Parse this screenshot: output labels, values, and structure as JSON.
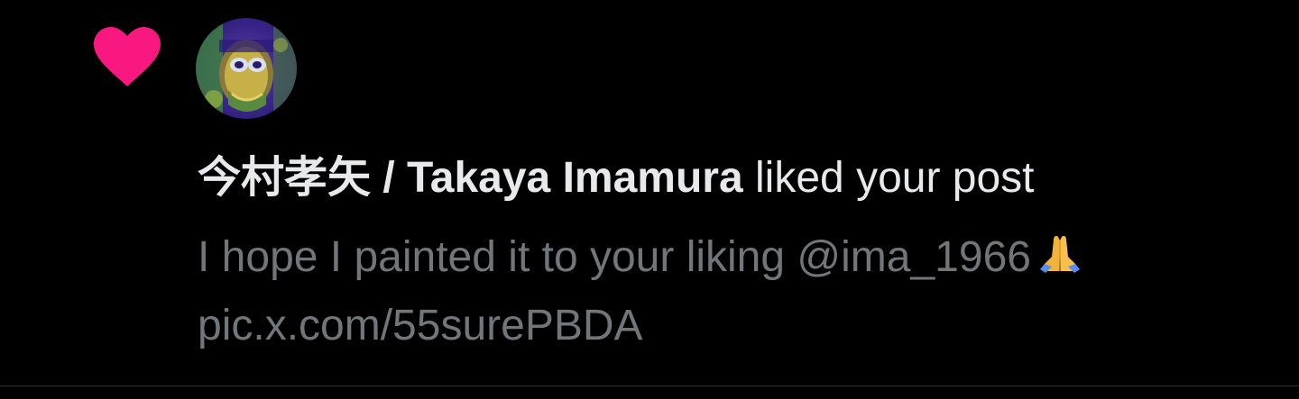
{
  "notification": {
    "icon": "heart-icon",
    "icon_color": "#f91880",
    "avatar_alt": "avatar",
    "user_name": "今村孝矢 / Takaya Imamura",
    "action_text": "liked your post",
    "post_text": "I hope I painted it to your liking @ima_1966",
    "post_emoji": "folded-hands-emoji",
    "post_link": "pic.x.com/55surePBDA"
  },
  "colors": {
    "background": "#000000",
    "primary_text": "#e7e9ea",
    "secondary_text": "#71767b",
    "divider": "#2f3336"
  }
}
